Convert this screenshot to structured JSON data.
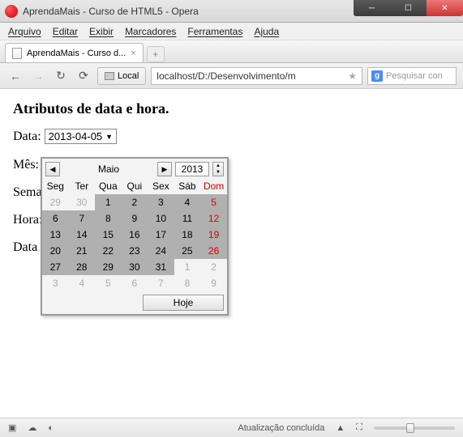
{
  "window": {
    "title": "AprendaMais - Curso de HTML5 - Opera"
  },
  "menu": {
    "items": [
      "Arquivo",
      "Editar",
      "Exibir",
      "Marcadores",
      "Ferramentas",
      "Ajuda"
    ]
  },
  "tab": {
    "title": "AprendaMais - Curso d..."
  },
  "address": {
    "local_label": "Local",
    "url": "localhost/D:/Desenvolvimento/m",
    "search_placeholder": "Pesquisar con"
  },
  "page": {
    "heading": "Atributos de data e hora.",
    "date_label": "Data:",
    "date_value": "2013-04-05",
    "month_label": "Mês:",
    "month_value": "2013-05",
    "week_label": "Sema",
    "time_label": "Hora:",
    "datetime_label": "Data"
  },
  "calendar": {
    "month": "Maio",
    "year": "2013",
    "weekdays": [
      "Seg",
      "Ter",
      "Qua",
      "Qui",
      "Sex",
      "Sáb",
      "Dom"
    ],
    "rows": [
      [
        {
          "d": "29",
          "o": true
        },
        {
          "d": "30",
          "o": true
        },
        {
          "d": "1",
          "s": true
        },
        {
          "d": "2",
          "s": true
        },
        {
          "d": "3",
          "s": true
        },
        {
          "d": "4",
          "s": true
        },
        {
          "d": "5",
          "s": true,
          "w": true
        }
      ],
      [
        {
          "d": "6",
          "s": true
        },
        {
          "d": "7",
          "s": true
        },
        {
          "d": "8",
          "s": true
        },
        {
          "d": "9",
          "s": true
        },
        {
          "d": "10",
          "s": true
        },
        {
          "d": "11",
          "s": true
        },
        {
          "d": "12",
          "s": true,
          "w": true
        }
      ],
      [
        {
          "d": "13",
          "s": true
        },
        {
          "d": "14",
          "s": true
        },
        {
          "d": "15",
          "s": true
        },
        {
          "d": "16",
          "s": true
        },
        {
          "d": "17",
          "s": true
        },
        {
          "d": "18",
          "s": true
        },
        {
          "d": "19",
          "s": true,
          "w": true
        }
      ],
      [
        {
          "d": "20",
          "s": true
        },
        {
          "d": "21",
          "s": true
        },
        {
          "d": "22",
          "s": true
        },
        {
          "d": "23",
          "s": true
        },
        {
          "d": "24",
          "s": true
        },
        {
          "d": "25",
          "s": true
        },
        {
          "d": "26",
          "s": true,
          "w": true
        }
      ],
      [
        {
          "d": "27",
          "s": true
        },
        {
          "d": "28",
          "s": true
        },
        {
          "d": "29",
          "s": true
        },
        {
          "d": "30",
          "s": true
        },
        {
          "d": "31",
          "s": true
        },
        {
          "d": "1",
          "o": true
        },
        {
          "d": "2",
          "o": true,
          "w": true
        }
      ],
      [
        {
          "d": "3",
          "o": true
        },
        {
          "d": "4",
          "o": true
        },
        {
          "d": "5",
          "o": true
        },
        {
          "d": "6",
          "o": true
        },
        {
          "d": "7",
          "o": true
        },
        {
          "d": "8",
          "o": true
        },
        {
          "d": "9",
          "o": true,
          "w": true
        }
      ]
    ],
    "today": "Hoje"
  },
  "status": {
    "text": "Atualização concluída"
  }
}
